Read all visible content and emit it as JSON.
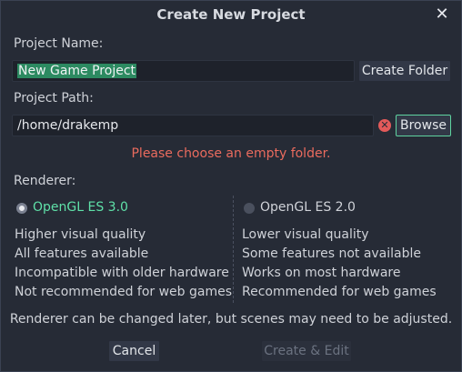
{
  "dialog": {
    "title": "Create New Project",
    "close_glyph": "✕"
  },
  "project_name": {
    "label": "Project Name:",
    "value": "New Game Project",
    "create_folder_label": "Create Folder"
  },
  "project_path": {
    "label": "Project Path:",
    "value": "/home/drakemp",
    "browse_label": "Browse",
    "error_icon": "error-icon",
    "error_message": "Please choose an empty folder."
  },
  "renderer": {
    "label": "Renderer:",
    "options": [
      {
        "name": "OpenGL ES 3.0",
        "selected": true,
        "lines": [
          "Higher visual quality",
          "All features available",
          "Incompatible with older hardware",
          "Not recommended for web games"
        ]
      },
      {
        "name": "OpenGL ES 2.0",
        "selected": false,
        "lines": [
          "Lower visual quality",
          "Some features not available",
          "Works on most hardware",
          "Recommended for web games"
        ]
      }
    ],
    "note": "Renderer can be changed later, but scenes may need to be adjusted."
  },
  "buttons": {
    "cancel": "Cancel",
    "create_edit": "Create & Edit"
  },
  "colors": {
    "accent": "#5fe0a8",
    "error": "#ea6b5e",
    "selection": "#2c8a61",
    "background": "#262b36"
  }
}
